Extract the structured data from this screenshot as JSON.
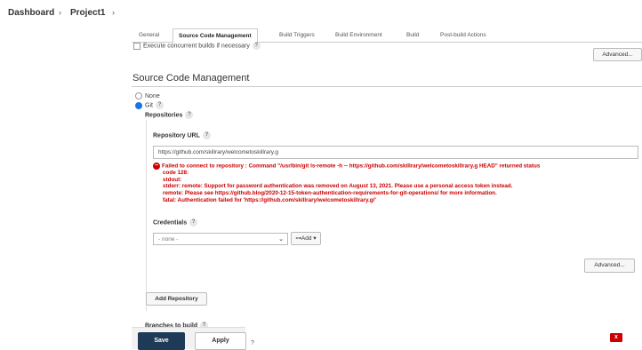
{
  "breadcrumb": {
    "items": [
      "Dashboard",
      "Project1"
    ],
    "separator": "›"
  },
  "tabs": [
    "General",
    "Source Code Management",
    "Build Triggers",
    "Build Environment",
    "Build",
    "Post-build Actions"
  ],
  "active_tab": "Source Code Management",
  "general": {
    "concurrent_label": "Execute concurrent builds if necessary"
  },
  "buttons": {
    "advanced": "Advanced...",
    "add_repository": "Add Repository",
    "add": "Add",
    "save": "Save",
    "apply": "Apply"
  },
  "scm": {
    "title": "Source Code Management",
    "options": [
      "None",
      "Git"
    ],
    "selected": "Git",
    "repositories_label": "Repositories",
    "repo_url_label": "Repository URL",
    "repo_url_value": "https://github.com/skillrary/welcometoskillrary.g",
    "error_lines": [
      "Failed to connect to repository : Command \"/usr/bin/git ls-remote -h -- https://github.com/skillrary/welcometoskillrary.g HEAD\" returned status",
      "code 128:",
      "stdout:",
      "stderr: remote: Support for password authentication was removed on August 13, 2021. Please use a personal access token instead.",
      "remote: Please see https://github.blog/2020-12-15-token-authentication-requirements-for-git-operations/ for more information.",
      "fatal: Authentication failed for 'https://github.com/skillrary/welcometoskillrary.g/'"
    ],
    "credentials_label": "Credentials",
    "credentials_value": "- none -",
    "branches_label": "Branches to build"
  },
  "colors": {
    "save_bg": "#1f3a56",
    "error": "#cc0000",
    "radio_selected": "#1a73e8"
  },
  "icons": {
    "help": "?",
    "error": "minus-circle-icon",
    "close": "x"
  }
}
